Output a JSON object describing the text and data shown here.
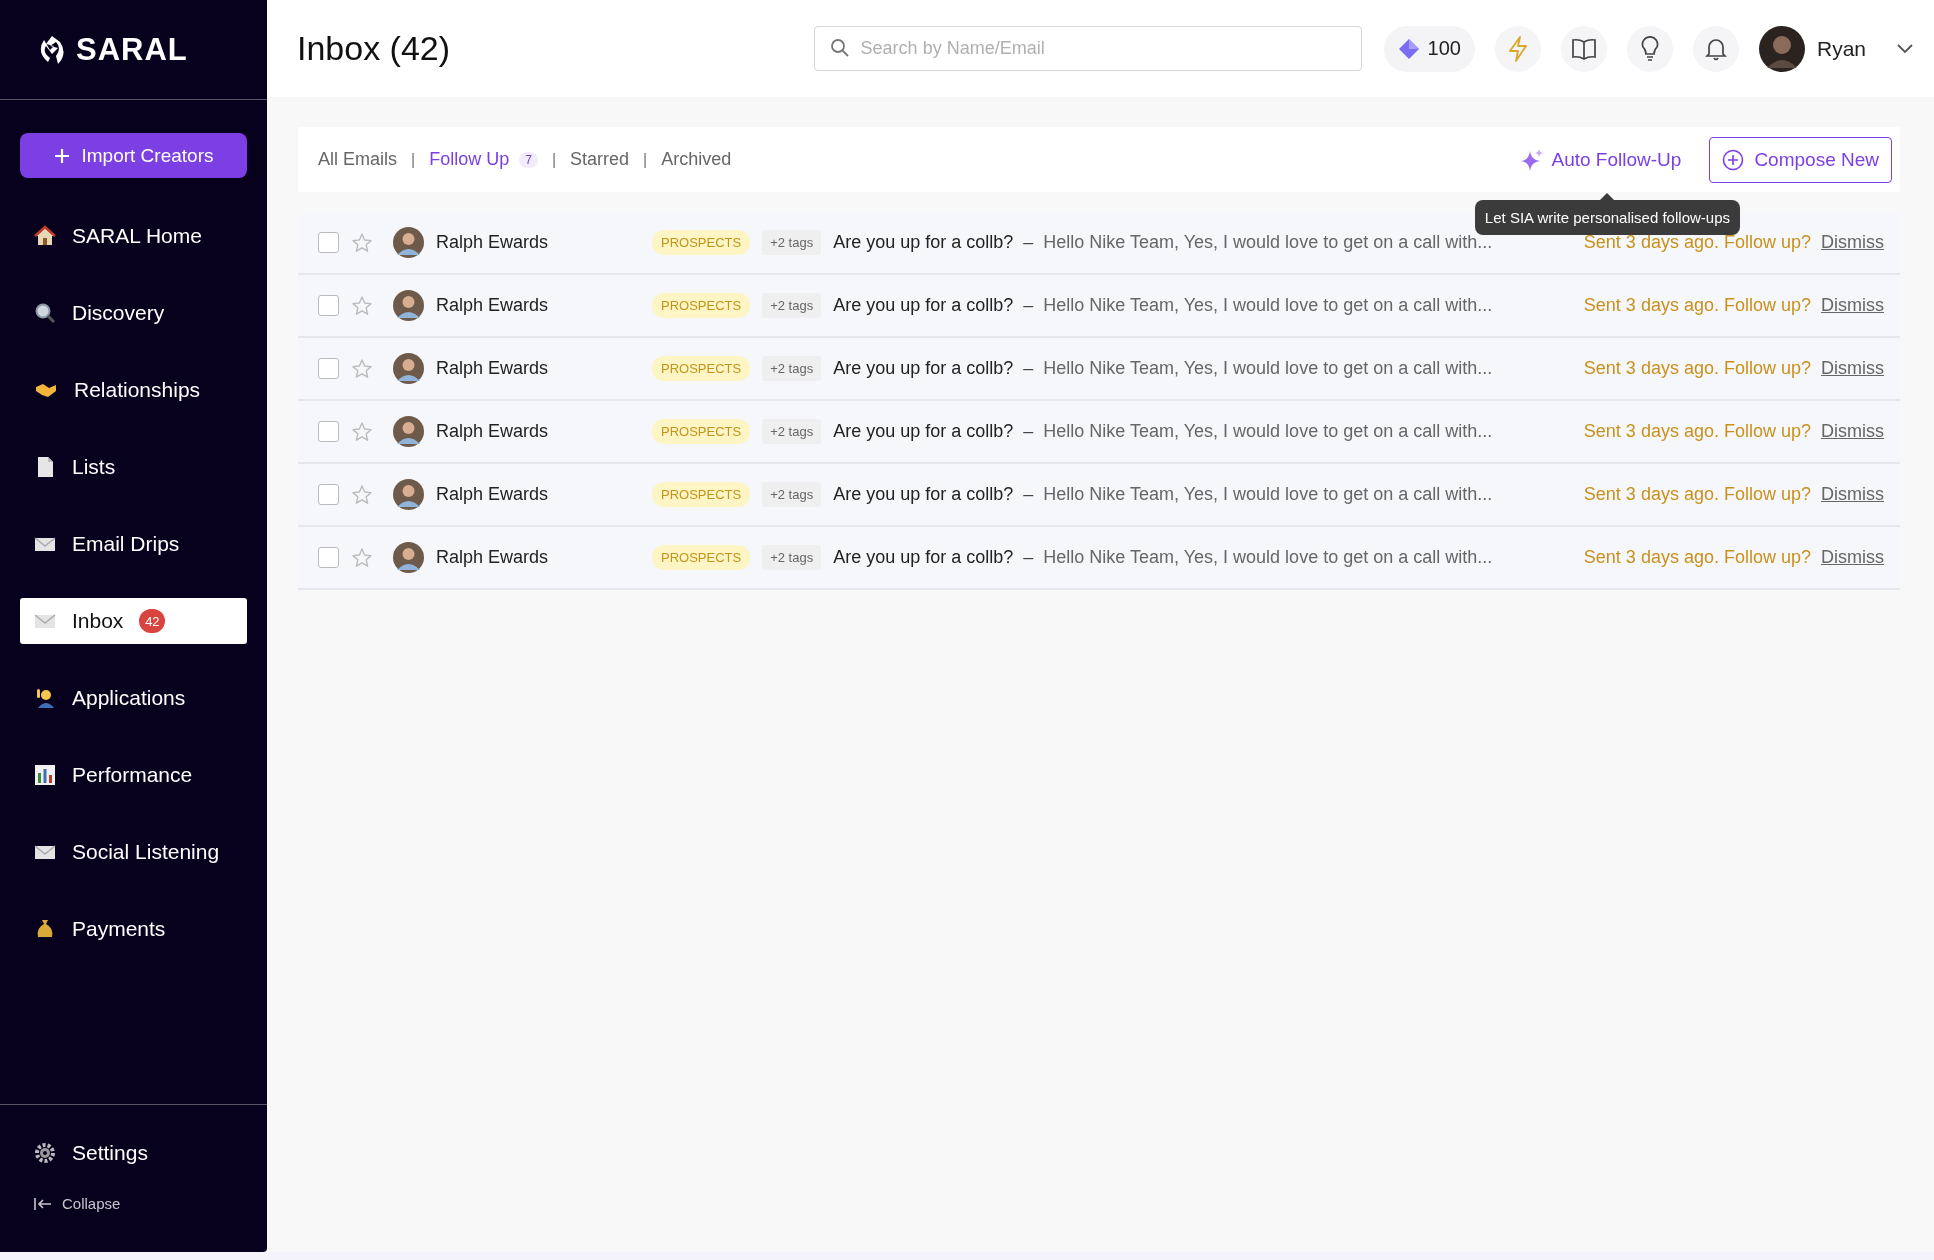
{
  "sidebar": {
    "logo": "SARAL",
    "import_button": "Import Creators",
    "items": [
      {
        "label": "SARAL Home",
        "selected": false
      },
      {
        "label": "Discovery",
        "selected": false
      },
      {
        "label": "Relationships",
        "selected": false
      },
      {
        "label": "Lists",
        "selected": false
      },
      {
        "label": "Email Drips",
        "selected": false
      },
      {
        "label": "Inbox",
        "selected": true,
        "badge": "42"
      },
      {
        "label": "Applications",
        "selected": false
      },
      {
        "label": "Performance",
        "selected": false
      },
      {
        "label": "Social Listening",
        "selected": false
      },
      {
        "label": "Payments",
        "selected": false
      }
    ],
    "settings": "Settings",
    "collapse": "Collapse"
  },
  "header": {
    "title": "Inbox (42)",
    "search": {
      "placeholder": "Search by Name/Email"
    },
    "credits": "100",
    "user": "Ryan"
  },
  "tabs": [
    {
      "label": "All Emails",
      "selected": false
    },
    {
      "label": "Follow Up",
      "selected": true,
      "count": "7",
      "separator_before": "|"
    },
    {
      "label": "Starred",
      "selected": false,
      "separator_before": "|"
    },
    {
      "label": "Archived",
      "selected": false,
      "separator_before": "|"
    }
  ],
  "auto_follow_up": "Auto Follow-Up",
  "tooltip": "Let SIA write personalised follow-ups",
  "compose": "Compose New",
  "rows": [
    {
      "checked": false,
      "starred": false,
      "name": "Ralph Ewards",
      "tag": "PROSPECTS",
      "extra_tags": "+2 tags",
      "subject": "Are you up for a collb?",
      "separator": "–",
      "preview": "Hello Nike Team, Yes, I would love to get on a call with...",
      "follow_up": "Sent 3 days ago. Follow up?",
      "dismiss": "Dismiss"
    },
    {
      "checked": false,
      "starred": false,
      "name": "Ralph Ewards",
      "tag": "PROSPECTS",
      "extra_tags": "+2 tags",
      "subject": "Are you up for a collb?",
      "separator": "–",
      "preview": "Hello Nike Team, Yes, I would love to get on a call with...",
      "follow_up": "Sent 3 days ago. Follow up?",
      "dismiss": "Dismiss"
    },
    {
      "checked": false,
      "starred": false,
      "name": "Ralph Ewards",
      "tag": "PROSPECTS",
      "extra_tags": "+2 tags",
      "subject": "Are you up for a collb?",
      "separator": "–",
      "preview": "Hello Nike Team, Yes, I would love to get on a call with...",
      "follow_up": "Sent 3 days ago. Follow up?",
      "dismiss": "Dismiss"
    },
    {
      "checked": false,
      "starred": false,
      "name": "Ralph Ewards",
      "tag": "PROSPECTS",
      "extra_tags": "+2 tags",
      "subject": "Are you up for a collb?",
      "separator": "–",
      "preview": "Hello Nike Team, Yes, I would love to get on a call with...",
      "follow_up": "Sent 3 days ago. Follow up?",
      "dismiss": "Dismiss"
    },
    {
      "checked": false,
      "starred": false,
      "name": "Ralph Ewards",
      "tag": "PROSPECTS",
      "extra_tags": "+2 tags",
      "subject": "Are you up for a collb?",
      "separator": "–",
      "preview": "Hello Nike Team, Yes, I would love to get on a call with...",
      "follow_up": "Sent 3 days ago. Follow up?",
      "dismiss": "Dismiss"
    },
    {
      "checked": false,
      "starred": false,
      "name": "Ralph Ewards",
      "tag": "PROSPECTS",
      "extra_tags": "+2 tags",
      "subject": "Are you up for a collb?",
      "separator": "–",
      "preview": "Hello Nike Team, Yes, I would love to get on a call with...",
      "follow_up": "Sent 3 days ago. Follow up?",
      "dismiss": "Dismiss"
    }
  ]
}
